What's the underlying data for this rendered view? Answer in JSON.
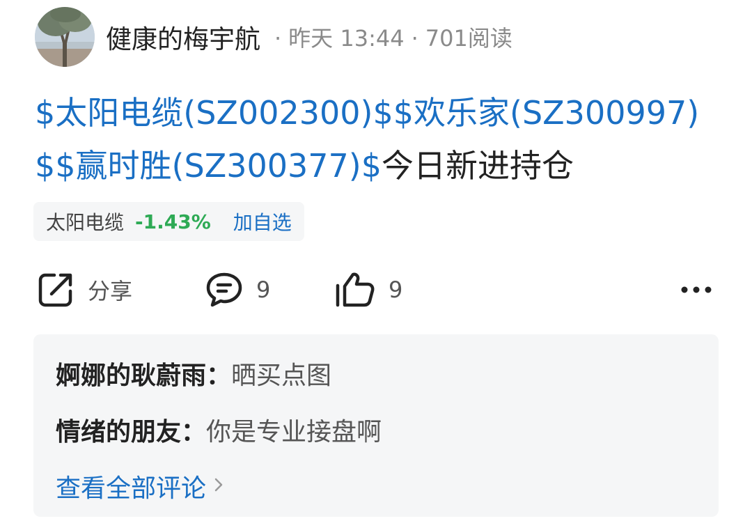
{
  "post": {
    "author": "健康的梅宇航",
    "separator": "·",
    "time": "昨天 13:44",
    "views": "701阅读",
    "text_segments": [
      {
        "text": "$太阳电缆(SZ002300)$",
        "link": true
      },
      {
        "text": "$欢乐家(SZ300997)$",
        "link": true
      },
      {
        "text": "$赢时胜(SZ300377)$",
        "link": true
      },
      {
        "text": "今日新进持仓",
        "link": false
      }
    ]
  },
  "stock_chip": {
    "name": "太阳电缆",
    "change": "-1.43%",
    "add_label": "加自选",
    "change_color": "#2eaa55"
  },
  "actions": {
    "share_label": "分享",
    "comment_count": "9",
    "like_count": "9",
    "share_icon": "share-icon",
    "comment_icon": "comment-icon",
    "like_icon": "thumbs-up-icon",
    "more_icon": "more-icon"
  },
  "comments": [
    {
      "user": "婀娜的耿蔚雨",
      "colon": "：",
      "text": "晒买点图"
    },
    {
      "user": "情绪的朋友",
      "colon": "：",
      "text": "你是专业接盘啊"
    }
  ],
  "view_all_label": "查看全部评论",
  "colors": {
    "link": "#1a6fc4",
    "negative_change": "#2eaa55",
    "meta": "#8a8a8a"
  }
}
